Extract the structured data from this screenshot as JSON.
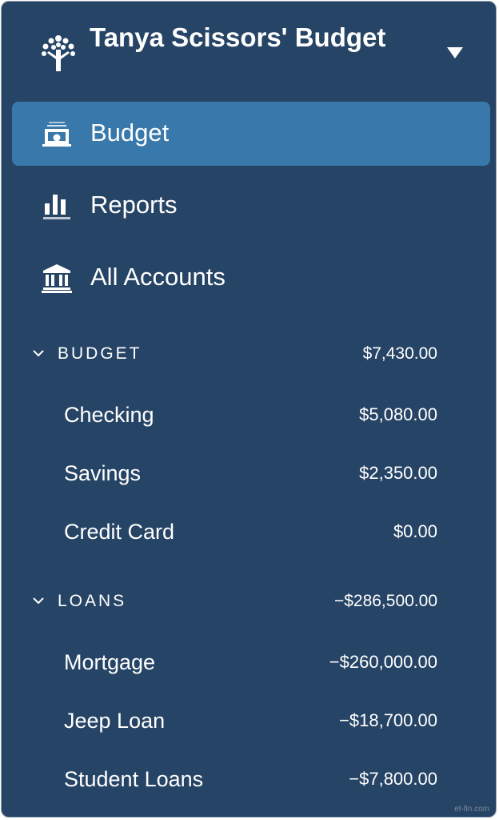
{
  "header": {
    "budget_name": "Tanya Scissors' Budget",
    "logo_icon": "tree-logo-icon",
    "menu_icon": "caret-down-icon"
  },
  "nav": [
    {
      "label": "Budget",
      "icon": "budget-icon",
      "active": true
    },
    {
      "label": "Reports",
      "icon": "bar-chart-icon",
      "active": false
    },
    {
      "label": "All Accounts",
      "icon": "bank-icon",
      "active": false
    }
  ],
  "groups": [
    {
      "label": "BUDGET",
      "total": "$7,430.00",
      "accounts": [
        {
          "name": "Checking",
          "balance": "$5,080.00"
        },
        {
          "name": "Savings",
          "balance": "$2,350.00"
        },
        {
          "name": "Credit Card",
          "balance": "$0.00"
        }
      ]
    },
    {
      "label": "LOANS",
      "total": "−$286,500.00",
      "accounts": [
        {
          "name": "Mortgage",
          "balance": "−$260,000.00"
        },
        {
          "name": "Jeep Loan",
          "balance": "−$18,700.00"
        },
        {
          "name": "Student Loans",
          "balance": "−$7,800.00"
        }
      ]
    }
  ],
  "watermark": "et-fin.com",
  "colors": {
    "sidebar_bg": "#264466",
    "active_bg": "#3878aa",
    "text": "#ffffff"
  }
}
